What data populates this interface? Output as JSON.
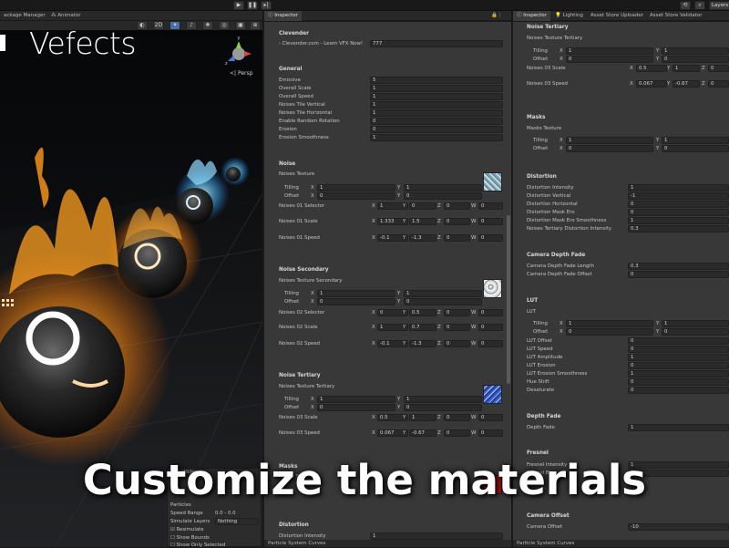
{
  "toolbar": {
    "left_tabs": [
      "ackage Manager",
      "Animator"
    ],
    "layers_label": "Layers"
  },
  "scene_view": {
    "logo_text": "Vefects",
    "persp_label": "<| Persp",
    "tool_labels": [
      "2D"
    ]
  },
  "particles_panel": {
    "title": "Particles",
    "rows": [
      {
        "label": "Particles",
        "value": ""
      },
      {
        "label": "Speed Range",
        "value": "0.0 - 0.0"
      },
      {
        "label": "Simulate Layers",
        "value": "Nothing"
      },
      {
        "label": "Resimulate",
        "value": "",
        "checked": true
      },
      {
        "label": "Show Bounds",
        "value": "",
        "checked": false
      },
      {
        "label": "Show Only Selected",
        "value": "",
        "checked": false
      }
    ]
  },
  "left_inspector": {
    "tab_label": "Inspector",
    "clevender": {
      "title": "Clevender",
      "link_label": "- Clevender.com - Learn VFX Now!",
      "link_value": "777"
    },
    "general": {
      "title": "General",
      "rows": [
        {
          "label": "Emissive",
          "value": "5"
        },
        {
          "label": "Overall Scale",
          "value": "1"
        },
        {
          "label": "Overall Speed",
          "value": "1"
        },
        {
          "label": "Noises Tile Vertical",
          "value": "1"
        },
        {
          "label": "Noises Tile Horizontal",
          "value": "1"
        },
        {
          "label": "Enable Random Rotation",
          "value": "0"
        },
        {
          "label": "Erosion",
          "value": "0"
        },
        {
          "label": "Erosion Smoothness",
          "value": "1"
        }
      ]
    },
    "noise": {
      "title": "Noise",
      "texture_label": "Noises Texture",
      "tiling_label": "Tilling",
      "tiling_x": "1",
      "tiling_y": "1",
      "offset_label": "Offset",
      "offset_x": "0",
      "offset_y": "0",
      "vec_rows": [
        {
          "label": "Noises 01 Selector",
          "x": "1",
          "y": "0",
          "z": "0",
          "w": "0"
        },
        {
          "label": "Noises 01 Scale",
          "x": "1.333",
          "y": "1.5",
          "z": "0",
          "w": "0"
        },
        {
          "label": "Noises 01 Speed",
          "x": "-0.1",
          "y": "-1.3",
          "z": "0",
          "w": "0"
        }
      ]
    },
    "noise_secondary": {
      "title": "Noise Secondary",
      "texture_label": "Noises Texture Secondary",
      "tiling_label": "Tilling",
      "tiling_x": "1",
      "tiling_y": "1",
      "offset_label": "Offset",
      "offset_x": "0",
      "offset_y": "0",
      "vec_rows": [
        {
          "label": "Noises 02 Selector",
          "x": "0",
          "y": "0.5",
          "z": "0",
          "w": "0"
        },
        {
          "label": "Noises 02 Scale",
          "x": "1",
          "y": "0.7",
          "z": "0",
          "w": "0"
        },
        {
          "label": "Noises 02 Speed",
          "x": "-0.1",
          "y": "-1.3",
          "z": "0",
          "w": "0"
        }
      ]
    },
    "noise_tertiary": {
      "title": "Noise Tertiary",
      "texture_label": "Noises Texture Tertiary",
      "tiling_label": "Tilling",
      "tiling_x": "1",
      "tiling_y": "1",
      "offset_label": "Offset",
      "offset_x": "0",
      "offset_y": "0",
      "vec_rows": [
        {
          "label": "Noises 03 Scale",
          "x": "0.5",
          "y": "1",
          "z": "0",
          "w": "0"
        },
        {
          "label": "Noises 03 Speed",
          "x": "0.067",
          "y": "-0.67",
          "z": "0",
          "w": "0"
        }
      ]
    },
    "masks": {
      "title": "Masks",
      "texture_label": "Masks Texture"
    },
    "distortion": {
      "title": "Distortion",
      "first_label": "Distortion Intensity",
      "first_value": "1"
    },
    "bottom_tab": "Particle System Curves"
  },
  "right_inspector": {
    "tabs": [
      "Inspector",
      "Lighting",
      "Asset Store Uploader",
      "Asset Store Validator"
    ],
    "noise_tertiary": {
      "title": "Noise Tertiary",
      "texture_label": "Noises Texture Tertiary",
      "tiling_label": "Tilling",
      "tiling_x": "1",
      "tiling_y": "1",
      "offset_label": "Offset",
      "offset_x": "0",
      "offset_y": "0",
      "vec_rows": [
        {
          "label": "Noises 03 Scale",
          "x": "0.5",
          "y": "1",
          "z": "0"
        },
        {
          "label": "Noises 03 Speed",
          "x": "0.067",
          "y": "-0.67",
          "z": "0"
        }
      ]
    },
    "masks": {
      "title": "Masks",
      "texture_label": "Masks Texture",
      "tiling_label": "Tilling",
      "tiling_x": "1",
      "tiling_y": "1",
      "offset_label": "Offset",
      "offset_x": "0",
      "offset_y": "0"
    },
    "distortion": {
      "title": "Distortion",
      "rows": [
        {
          "label": "Distortion Intensity",
          "value": "1"
        },
        {
          "label": "Distortion Vertical",
          "value": "-1"
        },
        {
          "label": "Distortion Horizontal",
          "value": "0"
        },
        {
          "label": "Distortion Mask Ero",
          "value": "0"
        },
        {
          "label": "Distortion Mask Ero Smoothness",
          "value": "1"
        },
        {
          "label": "Noises Tertiary Distortion Intensity",
          "value": "0.3"
        }
      ]
    },
    "camera_depth_fade": {
      "title": "Camera Depth Fade",
      "rows": [
        {
          "label": "Camera Depth Fade Length",
          "value": "0.3"
        },
        {
          "label": "Camera Depth Fade Offset",
          "value": "0"
        }
      ]
    },
    "lut": {
      "title": "LUT",
      "texture_label": "LUT",
      "tiling_label": "Tilling",
      "tiling_x": "1",
      "tiling_y": "1",
      "offset_label": "Offset",
      "offset_x": "0",
      "offset_y": "0",
      "rows": [
        {
          "label": "LUT Offset",
          "value": "0"
        },
        {
          "label": "LUT Speed",
          "value": "0"
        },
        {
          "label": "LUT Amplitude",
          "value": "1"
        },
        {
          "label": "LUT Erosion",
          "value": "0"
        },
        {
          "label": "LUT Erosion Smoothness",
          "value": "1"
        },
        {
          "label": "Hue Shift",
          "value": "0"
        },
        {
          "label": "Desaturate",
          "value": "0"
        }
      ]
    },
    "depth_fade": {
      "title": "Depth Fade",
      "rows": [
        {
          "label": "Depth Fade",
          "value": "1"
        }
      ]
    },
    "fresnel": {
      "title": "Fresnel",
      "rows": [
        {
          "label": "Fresnel Intensity",
          "value": "1"
        },
        {
          "label": "Fresnel Bias",
          "value": "0"
        }
      ]
    },
    "camera_offset": {
      "title": "Camera Offset",
      "rows": [
        {
          "label": "Camera Offset",
          "value": "-10"
        }
      ]
    },
    "bottom_tab": "Particle System Curves"
  },
  "caption": "Customize the materials",
  "colors": {
    "panel_bg": "#383838",
    "field_bg": "#2a2a2a",
    "tab_bg": "#282828",
    "fire_orange": "#ff9a1f",
    "ice_blue": "#4fc3ff"
  }
}
